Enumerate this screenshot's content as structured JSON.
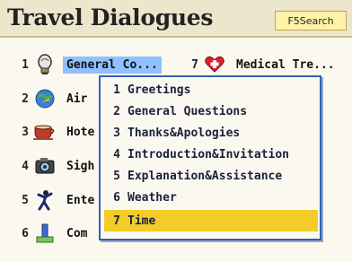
{
  "app": {
    "title": "Travel Dialogues",
    "search_button": "F5Search"
  },
  "categories_left": [
    {
      "num": "1",
      "label": "General Co...",
      "icon": "lightbulb-icon",
      "selected": true
    },
    {
      "num": "2",
      "label": "Air",
      "icon": "globe-plane-icon"
    },
    {
      "num": "3",
      "label": "Hote",
      "icon": "cup-icon"
    },
    {
      "num": "4",
      "label": "Sigh",
      "icon": "camera-icon"
    },
    {
      "num": "5",
      "label": "Ente",
      "icon": "dancer-icon"
    },
    {
      "num": "6",
      "label": "Com",
      "icon": "shopping-icon"
    }
  ],
  "categories_right": [
    {
      "num": "7",
      "label": "Medical Tre...",
      "icon": "heart-icon"
    }
  ],
  "popup": {
    "items": [
      {
        "num": "1",
        "label": "Greetings"
      },
      {
        "num": "2",
        "label": "General Questions"
      },
      {
        "num": "3",
        "label": "Thanks&Apologies"
      },
      {
        "num": "4",
        "label": "Introduction&Invitation"
      },
      {
        "num": "5",
        "label": "Explanation&Assistance"
      },
      {
        "num": "6",
        "label": "Weather"
      },
      {
        "num": "7",
        "label": "Time"
      }
    ],
    "selected_index": 6
  },
  "colors": {
    "title_bg": "#ebe6cc",
    "selection_blue": "#8fc0ff",
    "selection_yellow": "#f3cc2a",
    "popup_border": "#2d62b8"
  }
}
